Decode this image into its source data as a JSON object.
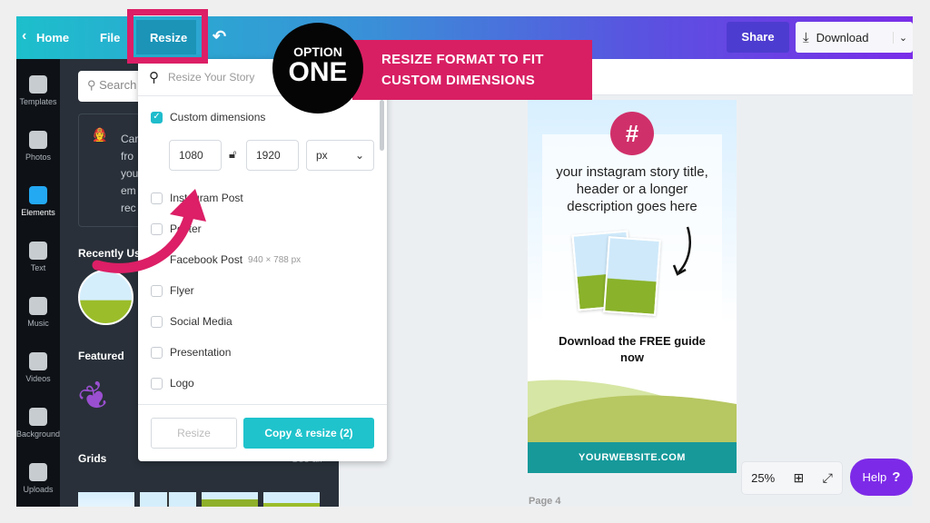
{
  "topbar": {
    "home": "Home",
    "file": "File",
    "resize": "Resize",
    "share": "Share",
    "download": "Download"
  },
  "rail": [
    {
      "label": "Templates",
      "icon": "templates-icon"
    },
    {
      "label": "Photos",
      "icon": "photos-icon"
    },
    {
      "label": "Elements",
      "icon": "elements-icon"
    },
    {
      "label": "Text",
      "icon": "text-icon"
    },
    {
      "label": "Music",
      "icon": "music-icon"
    },
    {
      "label": "Videos",
      "icon": "videos-icon"
    },
    {
      "label": "Background",
      "icon": "background-icon"
    },
    {
      "label": "Uploads",
      "icon": "uploads-icon"
    }
  ],
  "panel": {
    "search_placeholder": "Search",
    "tip_lines": [
      "Car",
      "fro",
      "you",
      "em",
      "rec"
    ],
    "recently_used": "Recently Used",
    "featured": "Featured",
    "grids": "Grids",
    "see_all": "See all"
  },
  "resize_menu": {
    "search_placeholder": "Resize Your Story",
    "custom_dimensions": "Custom dimensions",
    "custom_checked": true,
    "width": "1080",
    "height": "1920",
    "unit": "px",
    "options": [
      {
        "label": "Instagram Post"
      },
      {
        "label": "Poster"
      },
      {
        "label": "Facebook Post",
        "size": "940 × 788 px"
      },
      {
        "label": "Flyer"
      },
      {
        "label": "Social Media"
      },
      {
        "label": "Presentation"
      },
      {
        "label": "Logo"
      }
    ],
    "resize_button": "Resize",
    "copy_resize_button": "Copy & resize (2)"
  },
  "annotation": {
    "badge_line1": "OPTION",
    "badge_line2": "ONE",
    "banner_line1": "RESIZE FORMAT TO FIT",
    "banner_line2": "CUSTOM DIMENSIONS",
    "color": "#d81f63"
  },
  "design": {
    "hash": "#",
    "headline": "your instagram story title, header or a longer description goes here",
    "cta": "Download the FREE guide now",
    "footer": "YOURWEBSITE.COM"
  },
  "canvas": {
    "zoom": "25%",
    "page_label": "Page 4",
    "help": "Help",
    "help_icon": "?"
  },
  "colors": {
    "teal": "#1dbfcc",
    "purple": "#7d2ae8",
    "pink": "#d81f63"
  }
}
